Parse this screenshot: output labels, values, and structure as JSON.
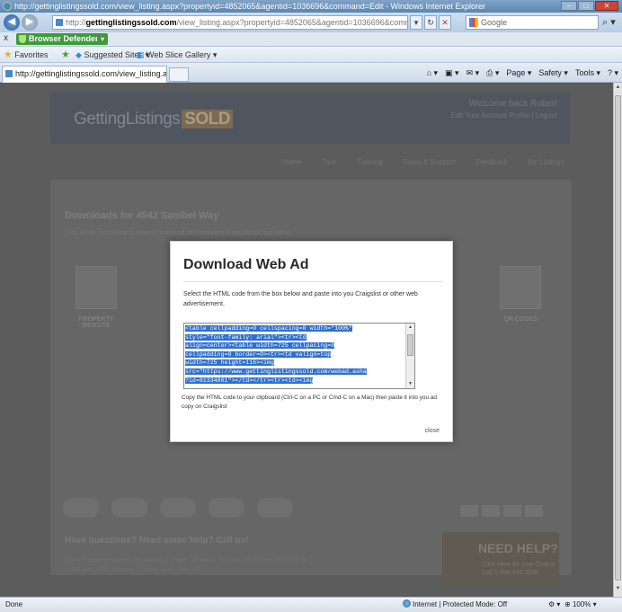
{
  "window": {
    "title": "http://gettinglistingssold.com/view_listing.aspx?propertyid=4852065&agentid=1036696&command=Edit - Windows Internet Explorer"
  },
  "address_bar": {
    "url_prefix": "http://",
    "url_domain": "gettinglistingssold.com",
    "url_rest": "/view_listing.aspx?propertyid=4852065&agentid=1036696&command=Edit",
    "search_placeholder": "Google"
  },
  "toolbar": {
    "close_label": "x",
    "browser_defender": "Browser Defender"
  },
  "favorites_bar": {
    "favorites": "Favorites",
    "suggested_sites": "Suggested Sites ▾",
    "web_slice_gallery": "Web Slice Gallery ▾"
  },
  "tabs": [
    {
      "label": "http://gettinglistingssold.com/view_listing.aspx?..."
    }
  ],
  "command_bar": {
    "page": "Page ▾",
    "safety": "Safety ▾",
    "tools": "Tools ▾"
  },
  "site": {
    "logo_text": "GettingListings",
    "logo_badge": "SOLD",
    "welcome": "Welcome back Robert",
    "welcome_links": "Edit Your Account Profile | Logout",
    "nav": [
      "Home",
      "Tour",
      "Training",
      "Sales & Support",
      "Feedback",
      "My Listings"
    ],
    "downloads_title": "Downloads for 4542 Sanibel Way",
    "downloads_sub": "Click on an icon below to view or download the marketing materials for this listing",
    "ghost_labels": [
      "PROPERTY WEBSITE",
      "QR CODES"
    ],
    "questions_title": "Have questions? Need some help? Call us!",
    "questions_body": "Our live representatives are always a phone call away. You can reach them Toll Free at 1.888.405.3638, Monday - Friday, 9am - 5pm ET.",
    "need_help": "NEED HELP?",
    "need_help_sub": "Click Here for Live Chat or Call 1.888.405.3638"
  },
  "modal": {
    "title": "Download Web Ad",
    "instructions": "Select the HTML code from the box below and paste into you Craigslist or other web advertisement.",
    "code": [
      "<table cellpadding=0 cellspacing=0 width=\"100%\"",
      "style=\"font-family: arial\"><tr><td",
      "align=center><table width=725 cellpacing=0",
      "cellpadding=0 border=0><tr><td valign=top",
      "width=725 height=116><img",
      "src=\"https://www.gettinglistingssold.com/webad.asha",
      "?id=81334861\"></td></tr><tr><td><img"
    ],
    "copy_note": "Copy the HTML code to your clipboard (Ctrl-C on a PC or Cmd-C on a Mac) then paste it into you ad copy on Craigslist",
    "close_label": "close"
  },
  "status_bar": {
    "left": "Done",
    "zone": "Internet | Protected Mode: Off",
    "zoom": "100%"
  }
}
